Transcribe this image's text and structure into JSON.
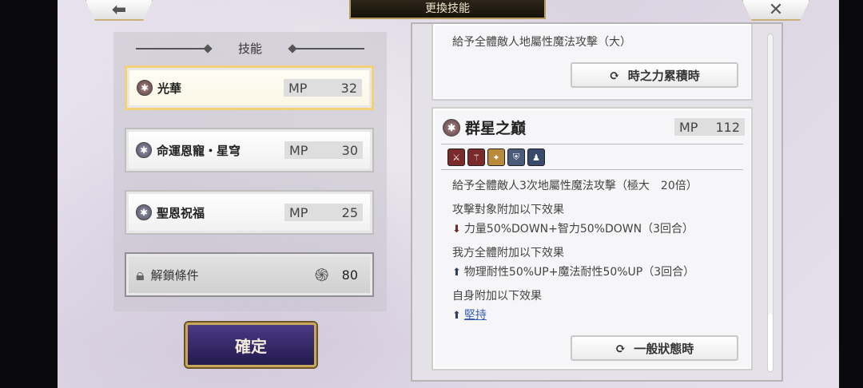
{
  "header": {
    "title": "更換技能",
    "back_icon": "arrow-left-icon",
    "close_icon": "close-icon"
  },
  "skill_list": {
    "heading": "技能",
    "skills": [
      {
        "name": "光華",
        "mp_label": "MP",
        "mp": "32",
        "selected": true
      },
      {
        "name": "命運恩寵・星穹",
        "mp_label": "MP",
        "mp": "30",
        "selected": false
      },
      {
        "name": "聖恩祝福",
        "mp_label": "MP",
        "mp": "25",
        "selected": false
      }
    ],
    "locked": {
      "label": "解鎖條件",
      "cost": "80",
      "icon": "lock-icon",
      "cost_icon": "spiral-icon"
    }
  },
  "confirm_label": "確定",
  "detail": {
    "card1": {
      "effect": "給予全體敵人地屬性魔法攻擊（大）",
      "state_button": "時之力累積時"
    },
    "card2": {
      "title": "群星之巔",
      "mp_label": "MP",
      "mp": "112",
      "main_effect": "給予全體敵人3次地屬性魔法攻擊（極大　20倍）",
      "target_heading": "攻擊對象附加以下效果",
      "target_effect": "力量50%DOWN+智力50%DOWN（3回合）",
      "ally_heading": "我方全體附加以下效果",
      "ally_effect": "物理耐性50%UP+魔法耐性50%UP（3回合）",
      "self_heading": "自身附加以下效果",
      "self_effect": "堅持",
      "state_button": "一般狀態時"
    }
  },
  "colors": {
    "selected_border": "#f3d277",
    "confirm_bg": "#3a2d6e",
    "gold": "#c8a65c"
  }
}
